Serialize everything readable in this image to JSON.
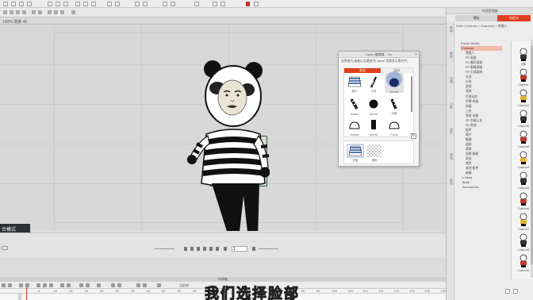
{
  "top_tab": {
    "label": "100% 场景 46"
  },
  "mode_badge": "台模式",
  "subtitle": "我们选择脸部",
  "playback": {
    "frame_value": "1",
    "fps_label": "当前帧"
  },
  "timeline": {
    "title": "时间轴",
    "ruler": [
      "5",
      "10",
      "15",
      "20",
      "25",
      "30",
      "35",
      "40",
      "45",
      "50",
      "55",
      "60",
      "65",
      "70",
      "75",
      "80",
      "85",
      "90",
      "95",
      "100",
      "105",
      "110",
      "115",
      "120",
      "125",
      "130",
      "135"
    ]
  },
  "popup": {
    "title": "Sprite 编辑器 · Yin",
    "close": "×",
    "hint": "选择图片(或者以右键选中) Sprite 切换显示素材中。",
    "tab_active": "条条",
    "tab_inactive": "服装",
    "cells": [
      {
        "label": "图片"
      },
      {
        "label": "头发"
      },
      {
        "label": "Ichreat"
      },
      {
        "label": "clothes"
      },
      {
        "label": "Ichreat"
      },
      {
        "label": "衣服"
      },
      {
        "label": "clothes"
      },
      {
        "label": "Ichreat"
      },
      {
        "label": "Pants"
      }
    ],
    "bottom_cells": [
      {
        "label": "衣服"
      },
      {
        "label": "透明"
      }
    ],
    "refresh": "↻"
  },
  "right_panel": {
    "title": "内容管理器",
    "tab_inactive": "模板",
    "tab_active": "自定义",
    "side_tabs": [
      "素材",
      "模板",
      "场景",
      "对象",
      "动作",
      "特效",
      "其他"
    ],
    "path": "Artist Contents > Character > 熊猫人",
    "tree": [
      "▾ Actor Studio",
      "Character",
      "熊猫人",
      "FE 面部",
      "FE 嘴巴表情",
      "FE 眼睛表情",
      "FE 头部表情",
      "头顶",
      "头发",
      "脸部",
      "身体",
      "手部动作",
      "手臂 衣服",
      "衣服",
      "上衣",
      "条纹 衣服",
      "FE 衣服上衣",
      "FE 其他",
      "配件",
      "帽子",
      "眼镜",
      "道具",
      "背景",
      "场景 服装",
      "条纹",
      "颜色",
      "其他 配件",
      "新建",
      "▸ Head",
      "Body",
      "Accessories"
    ],
    "thumbs": [
      "对象",
      "Costume",
      "Costume1",
      "Costume2",
      "Costume3",
      "Costume4",
      "Costume5",
      "Costume6",
      "Costume7",
      "Costume8",
      "Costume9"
    ]
  },
  "colors": {
    "accent": "#e0401f",
    "subtitle": "#ffe81a",
    "badge": "#2d3035"
  }
}
